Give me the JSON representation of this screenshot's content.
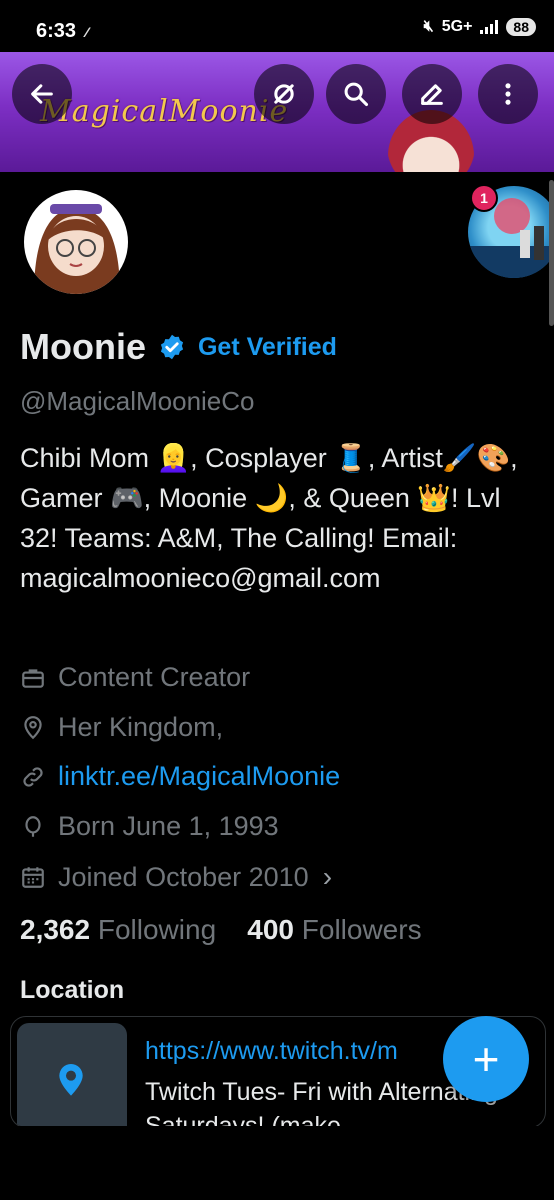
{
  "status_bar": {
    "time": "6:33",
    "network": "5G+",
    "battery": "88"
  },
  "banner": {
    "title": "MagicalMoonie"
  },
  "profile": {
    "name": "Moonie",
    "get_verified": "Get Verified",
    "handle": "@MagicalMoonieCo",
    "bio": "Chibi Mom 👱‍♀️, Cosplayer 🧵, Artist🖌️🎨, Gamer 🎮, Moonie 🌙, & Queen 👑! Lvl 32!  Teams: A&M, The Calling! Email: magicalmoonieco@gmail.com",
    "category": "Content Creator",
    "location": "Her Kingdom,",
    "website": "linktr.ee/MagicalMoonie",
    "birthday": "Born June 1, 1993",
    "joined": "Joined October 2010",
    "following_count": "2,362",
    "following_label": "Following",
    "followers_count": "400",
    "followers_label": "Followers"
  },
  "story_badge": "1",
  "location_section": {
    "label": "Location",
    "url": "https://www.twitch.tv/m",
    "description": "Twitch Tues- Fri with Alternating Saturdays! (make"
  },
  "colors": {
    "accent": "#1d9bf0",
    "muted": "#71767b",
    "background": "#000000"
  }
}
